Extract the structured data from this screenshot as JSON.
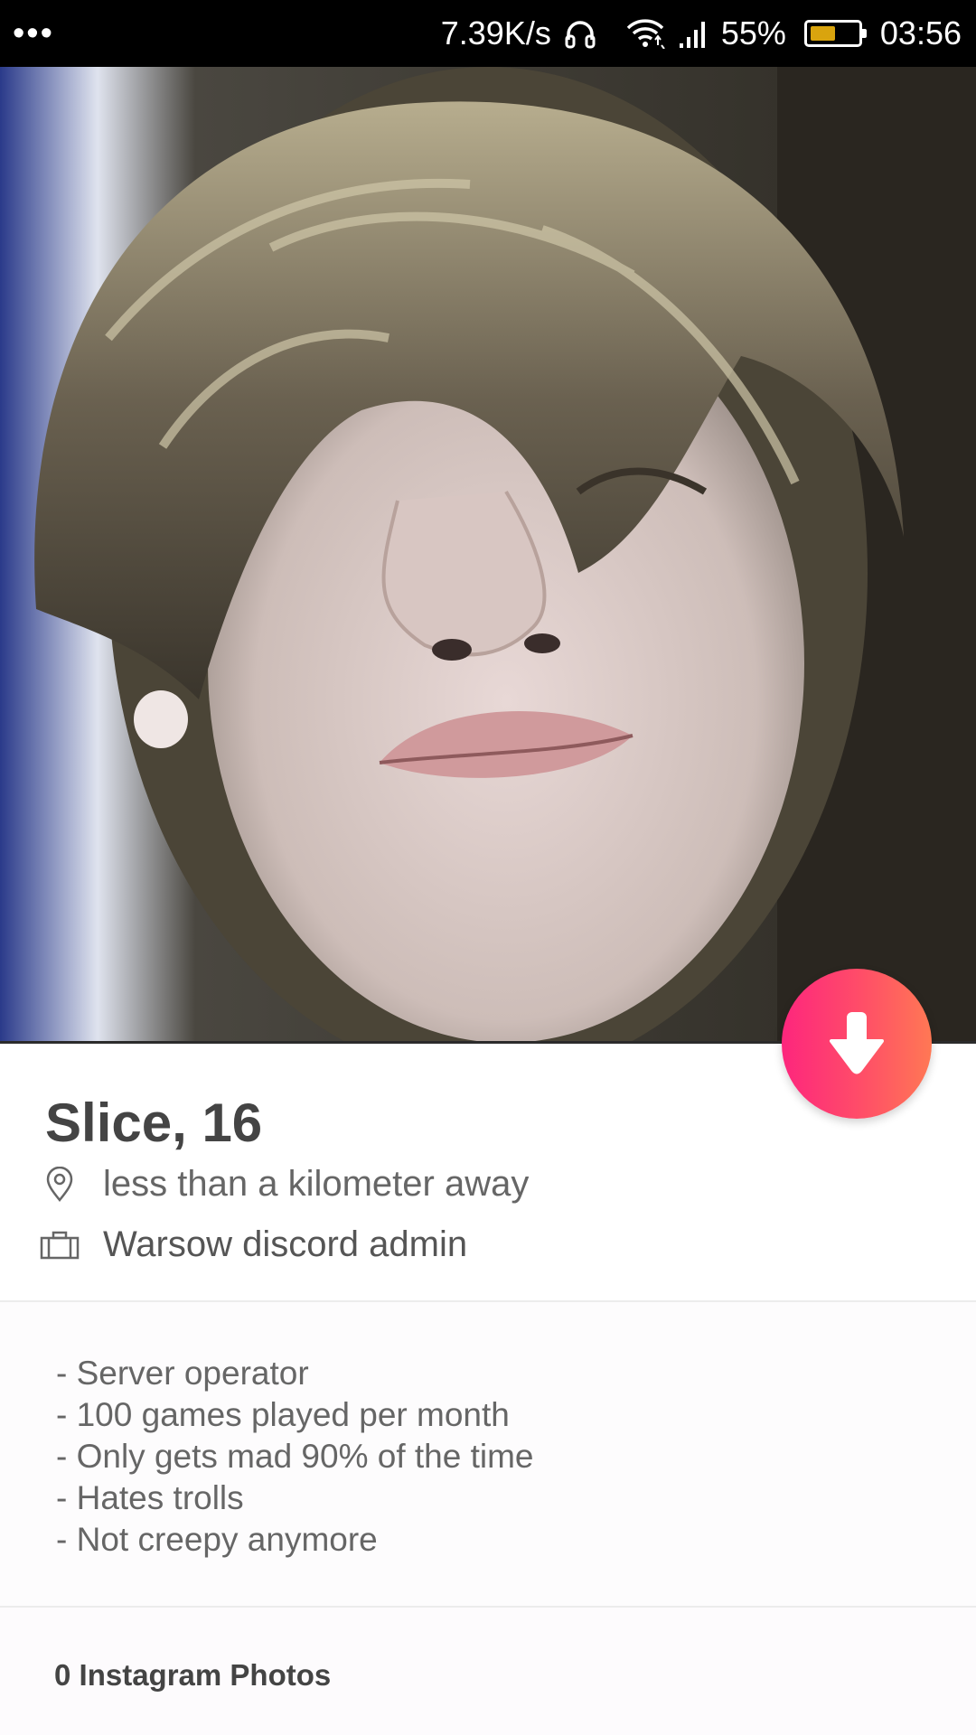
{
  "status_bar": {
    "menu_dots": "•••",
    "network_speed": "7.39K/s",
    "battery_percent": "55%",
    "battery_level": 0.55,
    "time": "03:56",
    "icons": [
      "headphones-icon",
      "wifi-icon",
      "signal-icon",
      "battery-icon"
    ]
  },
  "photo": {
    "description_icon": "profile-photo"
  },
  "action_button": {
    "icon": "arrow-down-icon",
    "gradient_colors": [
      "#fd267d",
      "#ff4f67",
      "#ff7854"
    ]
  },
  "profile": {
    "name_age": "Slice, 16",
    "distance": "less than a kilometer away",
    "job": "Warsow discord admin"
  },
  "bio": {
    "lines": [
      "- Server operator",
      "- 100 games played per month",
      "- Only gets mad 90% of the time",
      "- Hates trolls",
      "- Not creepy anymore"
    ]
  },
  "instagram": {
    "label": "0 Instagram Photos"
  }
}
